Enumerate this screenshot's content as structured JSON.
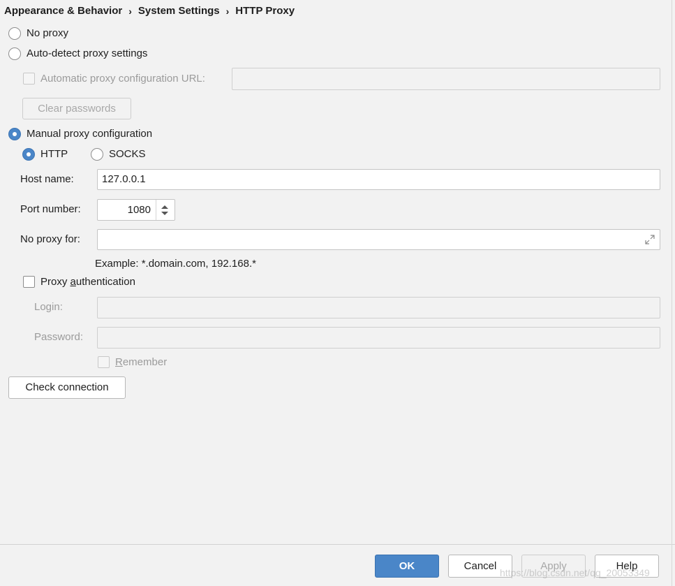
{
  "breadcrumb": [
    "Appearance & Behavior",
    "System Settings",
    "HTTP Proxy"
  ],
  "breadcrumb_separator": "›",
  "proxy_options": {
    "no_proxy": "No proxy",
    "auto_detect": "Auto-detect proxy settings",
    "auto_config_url_label": "Automatic proxy configuration URL:",
    "auto_config_url_value": "",
    "clear_passwords": "Clear passwords",
    "manual": "Manual proxy configuration",
    "selected": "manual"
  },
  "protocol": {
    "http": "HTTP",
    "socks": "SOCKS",
    "selected": "http"
  },
  "host": {
    "label": "Host name:",
    "value": "127.0.0.1"
  },
  "port": {
    "label": "Port number:",
    "value": "1080"
  },
  "no_proxy_for": {
    "label": "No proxy for:",
    "value": "",
    "example": "Example: *.domain.com, 192.168.*"
  },
  "auth": {
    "checkbox_prefix": "Proxy ",
    "checkbox_mnemonic": "a",
    "checkbox_rest": "uthentication",
    "checked": false,
    "login_label": "Login:",
    "login_value": "",
    "password_label": "Password:",
    "password_value": "",
    "remember_mnemonic": "R",
    "remember_rest": "emember"
  },
  "check_connection": "Check connection",
  "footer": {
    "ok": "OK",
    "cancel": "Cancel",
    "apply": "Apply",
    "help": "Help"
  },
  "watermark": "https://blog.csdn.net/qq_20053349",
  "colors": {
    "accent": "#4a86c8",
    "background": "#f2f2f2",
    "disabled_text": "#9b9b9b"
  }
}
